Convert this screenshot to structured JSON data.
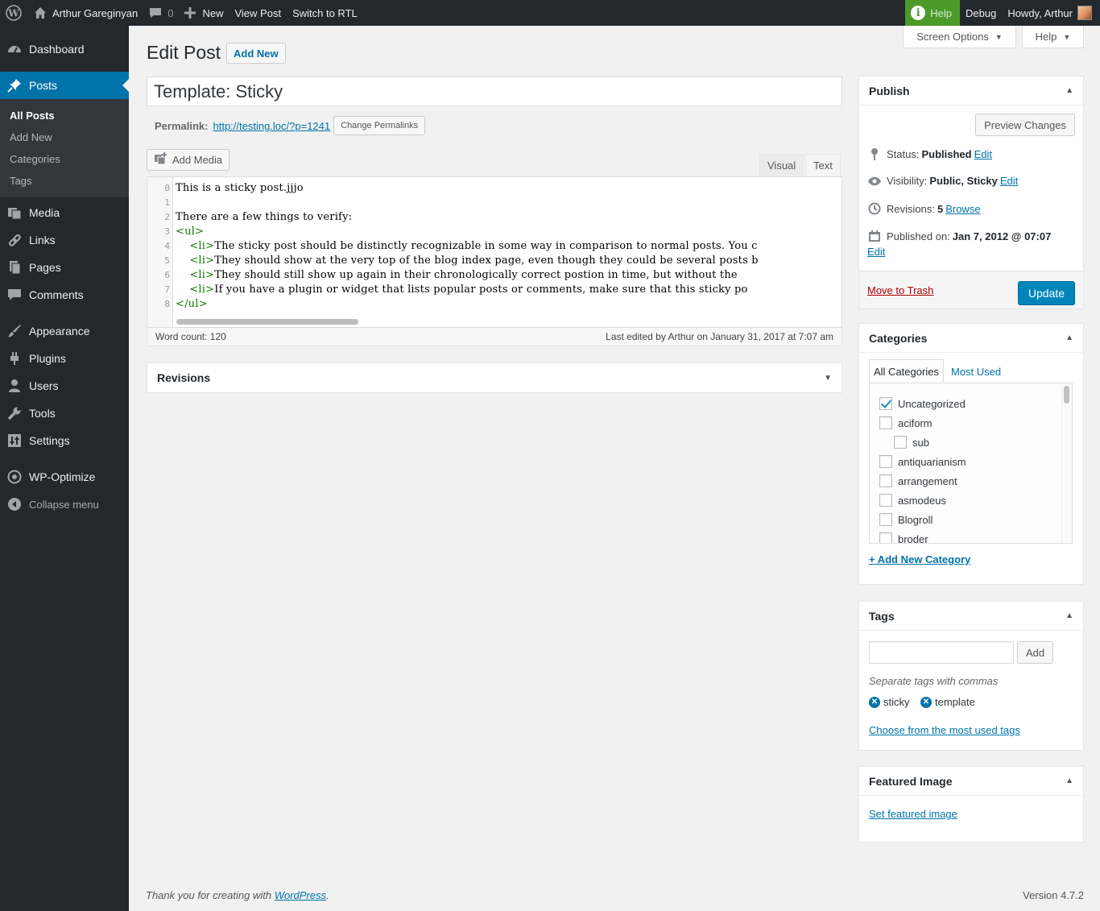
{
  "admin_bar": {
    "site_name": "Arthur Gareginyan",
    "comments_count": "0",
    "new_label": "New",
    "view_post": "View Post",
    "switch_rtl": "Switch to RTL",
    "help": "Help",
    "debug": "Debug",
    "howdy": "Howdy, Arthur"
  },
  "sidebar": {
    "dashboard": "Dashboard",
    "posts": "Posts",
    "posts_sub": [
      "All Posts",
      "Add New",
      "Categories",
      "Tags"
    ],
    "media": "Media",
    "links": "Links",
    "pages": "Pages",
    "comments": "Comments",
    "appearance": "Appearance",
    "plugins": "Plugins",
    "users": "Users",
    "tools": "Tools",
    "settings": "Settings",
    "wp_optimize": "WP-Optimize",
    "collapse": "Collapse menu"
  },
  "screen_options": {
    "screen_options": "Screen Options",
    "help": "Help"
  },
  "page": {
    "title": "Edit Post",
    "add_new": "Add New",
    "post_title": "Template: Sticky",
    "permalink_label": "Permalink:",
    "permalink_url": "http://testing.loc/?p=1241",
    "change_permalinks": "Change Permalinks",
    "add_media": "Add Media",
    "tab_visual": "Visual",
    "tab_text": "Text"
  },
  "editor": {
    "lines": [
      {
        "num": "0",
        "parts": [
          [
            "t",
            "This is a sticky post.jjjo"
          ]
        ]
      },
      {
        "num": "1",
        "parts": []
      },
      {
        "num": "2",
        "parts": [
          [
            "t",
            "There are a few things to verify:"
          ]
        ]
      },
      {
        "num": "3",
        "parts": [
          [
            "g",
            "<ul>"
          ]
        ]
      },
      {
        "num": "4",
        "parts": [
          [
            "t",
            "    "
          ],
          [
            "g",
            "<li>"
          ],
          [
            "t",
            "The sticky post should be distinctly recognizable in some way in comparison to normal posts. You c"
          ]
        ]
      },
      {
        "num": "5",
        "parts": [
          [
            "t",
            "    "
          ],
          [
            "g",
            "<li>"
          ],
          [
            "t",
            "They should show at the very top of the blog index page, even though they could be several posts b"
          ]
        ]
      },
      {
        "num": "6",
        "parts": [
          [
            "t",
            "    "
          ],
          [
            "g",
            "<li>"
          ],
          [
            "t",
            "They should still show up again in their chronologically correct postion in time, but without the"
          ]
        ]
      },
      {
        "num": "7",
        "parts": [
          [
            "t",
            "    "
          ],
          [
            "g",
            "<li>"
          ],
          [
            "t",
            "If you have a plugin or widget that lists popular posts or comments, make sure that this sticky po"
          ]
        ]
      },
      {
        "num": "8",
        "parts": [
          [
            "g",
            "</ul>"
          ]
        ]
      }
    ],
    "word_count": "Word count: 120",
    "last_edited": "Last edited by Arthur on January 31, 2017 at 7:07 am"
  },
  "revisions_box": {
    "title": "Revisions"
  },
  "publish": {
    "title": "Publish",
    "preview": "Preview Changes",
    "status_label": "Status:",
    "status_value": "Published",
    "visibility_label": "Visibility:",
    "visibility_value": "Public, Sticky",
    "revisions_label": "Revisions:",
    "revisions_value": "5",
    "browse": "Browse",
    "published_label": "Published on:",
    "published_value": "Jan 7, 2012 @ 07:07",
    "edit": "Edit",
    "trash": "Move to Trash",
    "update": "Update"
  },
  "categories": {
    "title": "Categories",
    "tab_all": "All Categories",
    "tab_most_used": "Most Used",
    "items": [
      {
        "label": "Uncategorized",
        "checked": true,
        "indent": 0
      },
      {
        "label": "aciform",
        "checked": false,
        "indent": 0
      },
      {
        "label": "sub",
        "checked": false,
        "indent": 1
      },
      {
        "label": "antiquarianism",
        "checked": false,
        "indent": 0
      },
      {
        "label": "arrangement",
        "checked": false,
        "indent": 0
      },
      {
        "label": "asmodeus",
        "checked": false,
        "indent": 0
      },
      {
        "label": "Blogroll",
        "checked": false,
        "indent": 0
      },
      {
        "label": "broder",
        "checked": false,
        "indent": 0
      }
    ],
    "add_new": "+ Add New Category"
  },
  "tags": {
    "title": "Tags",
    "add": "Add",
    "hint": "Separate tags with commas",
    "items": [
      "sticky",
      "template"
    ],
    "choose": "Choose from the most used tags"
  },
  "featured": {
    "title": "Featured Image",
    "set": "Set featured image"
  },
  "footer": {
    "thanks": "Thank you for creating with ",
    "wordpress": "WordPress",
    "version": "Version 4.7.2"
  },
  "colors": {
    "accent": "#0073aa",
    "sidebar": "#23282d",
    "help_green": "#4c9a2a",
    "update_btn": "#0085ba",
    "trash": "#aa0000"
  }
}
